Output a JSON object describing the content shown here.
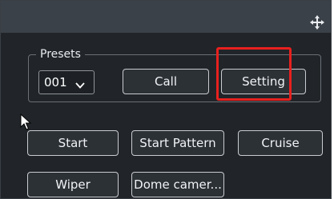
{
  "titlebar": {
    "move_icon": "move-arrows-icon"
  },
  "presets": {
    "legend": "Presets",
    "selected_value": "001",
    "call_label": "Call",
    "setting_label": "Setting"
  },
  "highlight": {
    "color": "#e8201e",
    "target": "Setting"
  },
  "actions": {
    "start_label": "Start",
    "start_pattern_label": "Start Pattern",
    "cruise_label": "Cruise",
    "wiper_label": "Wiper",
    "dome_camera_label": "Dome camer..."
  },
  "colors": {
    "panel_background": "#212529",
    "titlebar_background": "#3b4148",
    "button_border": "#c9ccd0"
  }
}
